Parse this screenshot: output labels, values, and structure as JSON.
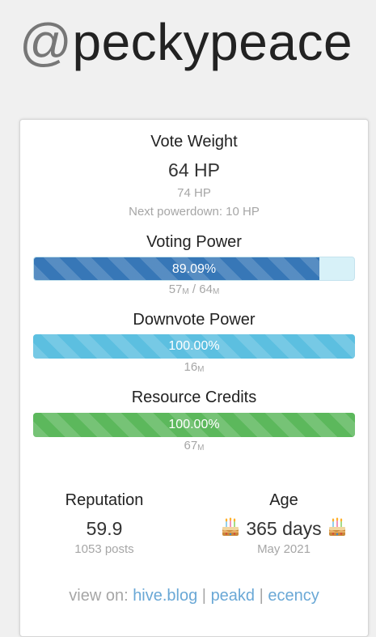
{
  "profile": {
    "at": "@",
    "username": "peckypeace"
  },
  "vote_weight": {
    "title": "Vote Weight",
    "value": "64 HP",
    "secondary": "74 HP",
    "next_powerdown": "Next powerdown: 10 HP"
  },
  "voting_power": {
    "title": "Voting Power",
    "percent": 89.09,
    "percent_label": "89.09%",
    "current": "57",
    "max": "64",
    "unit": "M",
    "separator": " / "
  },
  "downvote_power": {
    "title": "Downvote Power",
    "percent": 100,
    "percent_label": "100.00%",
    "current": "16",
    "unit": "M"
  },
  "resource_credits": {
    "title": "Resource Credits",
    "percent": 100,
    "percent_label": "100.00%",
    "current": "67",
    "unit": "M"
  },
  "reputation": {
    "title": "Reputation",
    "value": "59.9",
    "posts": "1053 posts"
  },
  "age": {
    "title": "Age",
    "value": "365 days",
    "since": "May 2021",
    "icon": "birthday-cake-icon"
  },
  "footer": {
    "prefix": "view on: ",
    "links": [
      "hive.blog",
      "peakd",
      "ecency"
    ],
    "separator": " | "
  },
  "colors": {
    "voting_fill": "#3777b7",
    "voting_track": "#d7f1f8",
    "downvote_fill": "#5cbfe0",
    "rc_fill": "#5cb85c",
    "link": "#6aa8d6",
    "muted": "#a6a6a6"
  }
}
